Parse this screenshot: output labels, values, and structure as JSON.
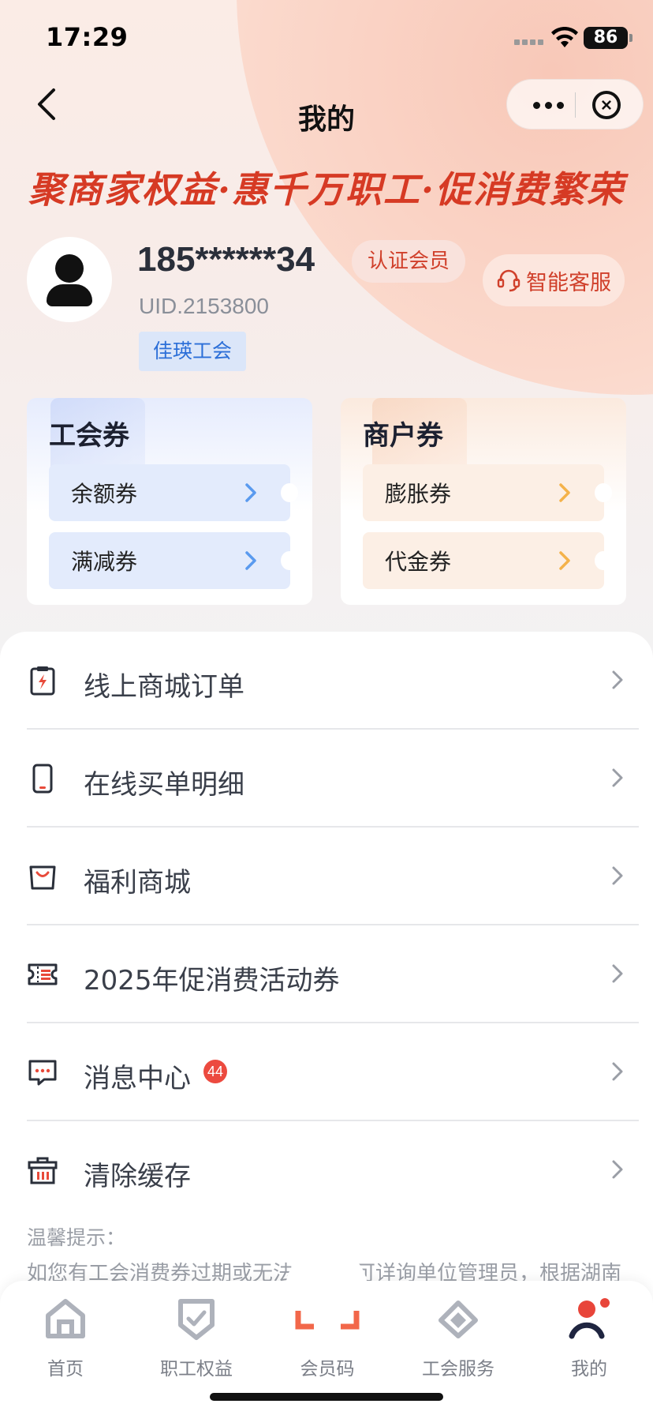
{
  "status_bar": {
    "time": "17:29",
    "battery": "86"
  },
  "nav": {
    "title": "我的"
  },
  "slogan": "聚商家权益·惠千万职工·促消费繁荣",
  "profile": {
    "phone": "185******34",
    "cert_badge": "认证会员",
    "uid": "UID.2153800",
    "union_tag": "佳瑛工会",
    "service_label": "智能客服"
  },
  "coupons": {
    "union": {
      "title": "工会券",
      "items": [
        "余额券",
        "满减券"
      ]
    },
    "merchant": {
      "title": "商户券",
      "items": [
        "膨胀券",
        "代金券"
      ]
    }
  },
  "menu": [
    {
      "label": "线上商城订单",
      "icon": "order-clipboard-icon"
    },
    {
      "label": "在线买单明细",
      "icon": "phone-icon"
    },
    {
      "label": "福利商城",
      "icon": "shopping-bag-icon"
    },
    {
      "label": "2025年促消费活动券",
      "icon": "ticket-icon"
    },
    {
      "label": "消息中心",
      "icon": "message-icon",
      "badge": "44"
    },
    {
      "label": "清除缓存",
      "icon": "broom-basket-icon"
    }
  ],
  "tips": {
    "title": "温馨提示：",
    "text": "如您有工会消费券过期或无法使用，可详询单位管理员，根据湖南"
  },
  "tabbar": [
    {
      "label": "首页",
      "icon": "home-icon"
    },
    {
      "label": "职工权益",
      "icon": "shield-check-icon"
    },
    {
      "label": "会员码",
      "icon": "scan-icon"
    },
    {
      "label": "工会服务",
      "icon": "handshake-icon"
    },
    {
      "label": "我的",
      "icon": "user-icon"
    }
  ],
  "colors": {
    "accent_red": "#d0402b",
    "blue_tag": "#2c6fd8",
    "orange_chevron": "#f4b24a",
    "blue_chevron": "#5a9aef"
  }
}
